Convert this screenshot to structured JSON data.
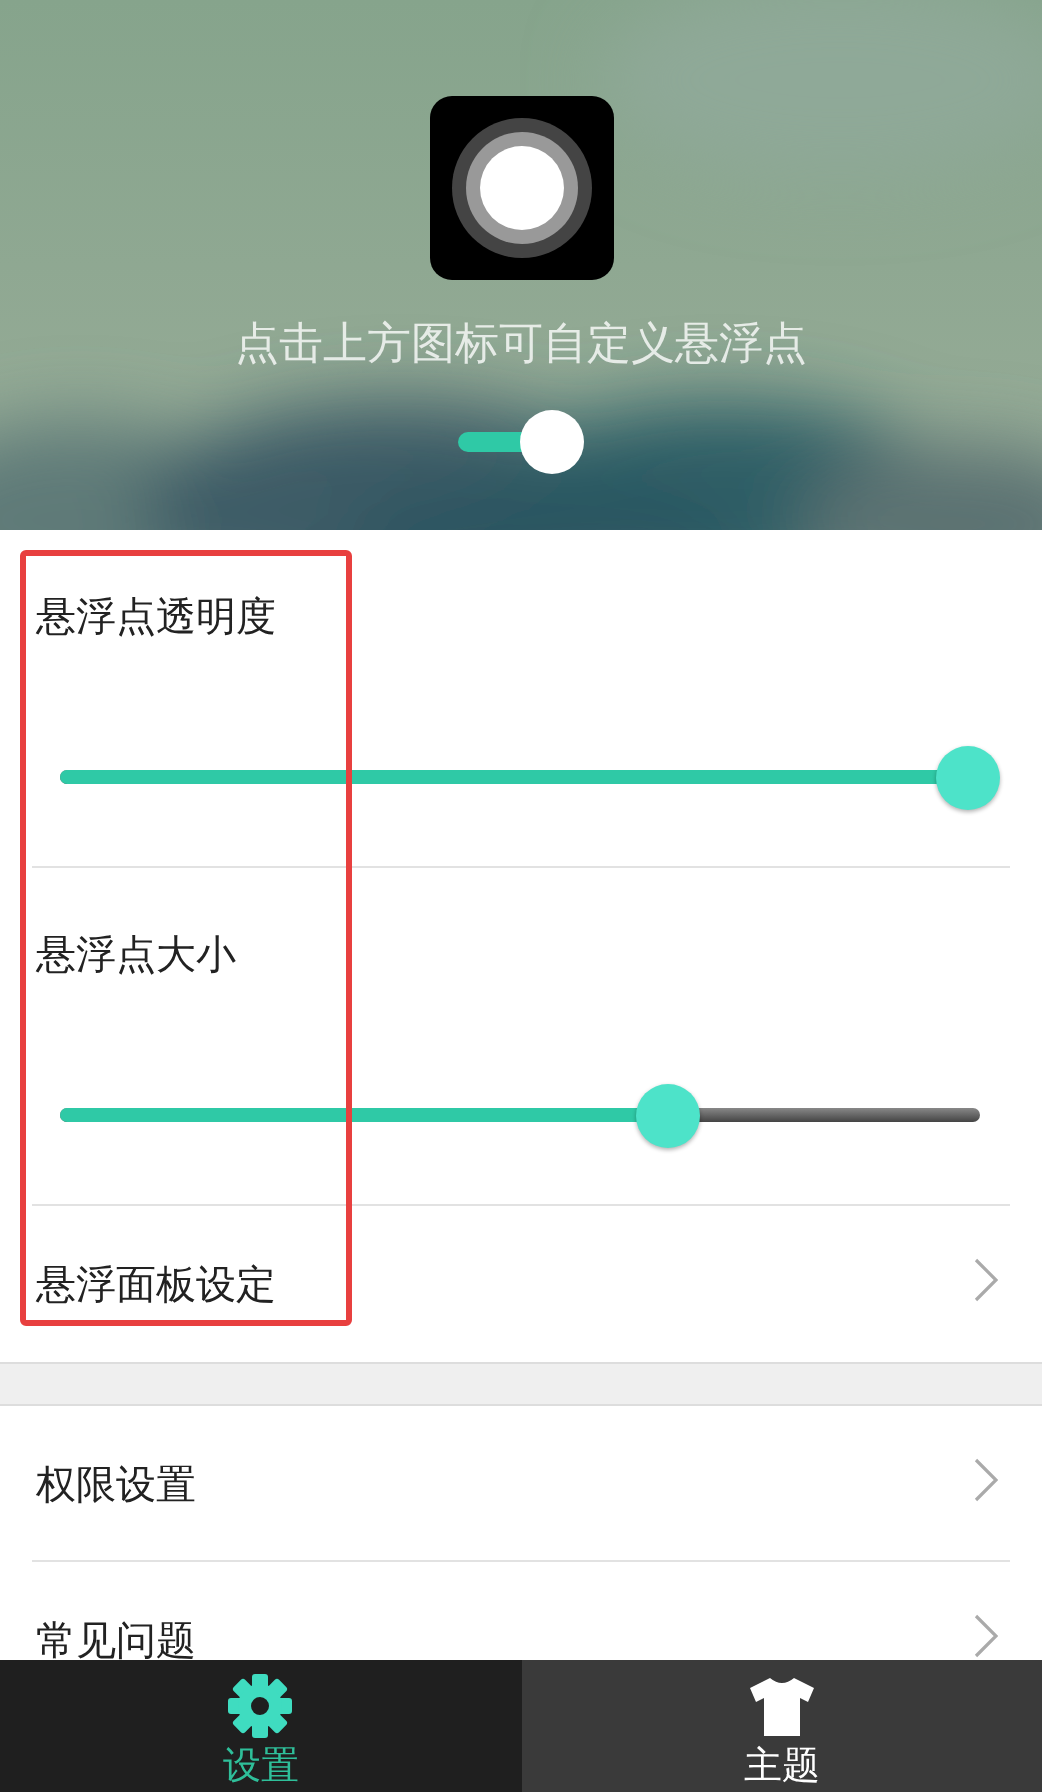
{
  "header": {
    "caption": "点击上方图标可自定义悬浮点",
    "float_enabled": true
  },
  "sections": [
    {
      "rows": [
        {
          "kind": "slider",
          "label": "悬浮点透明度",
          "level": 0.99
        },
        {
          "kind": "slider",
          "label": "悬浮点大小",
          "level": 0.66
        },
        {
          "kind": "link",
          "label": "悬浮面板设定"
        }
      ]
    },
    {
      "rows": [
        {
          "kind": "link",
          "label": "权限设置"
        },
        {
          "kind": "link",
          "label": "常见问题"
        }
      ]
    }
  ],
  "tab_bar": [
    {
      "kind": "settings",
      "label": "设置",
      "selected": true
    },
    {
      "kind": "theme",
      "label": "主题",
      "selected": false
    }
  ]
}
